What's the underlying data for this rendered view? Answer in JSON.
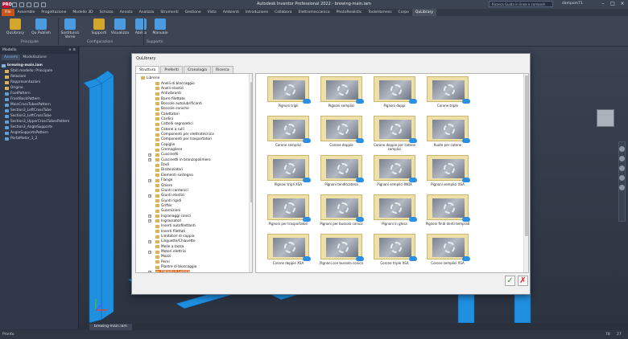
{
  "window": {
    "title": "Autodesk Inventor Professional 2022 - brewing-main.iam",
    "help_search_placeholder": "Ricerca Guida in linea e comandi",
    "user": "dampom71",
    "app_logo": "PRO"
  },
  "menu_tabs": [
    "File",
    "Assemble",
    "Progettazione",
    "Modello 3D",
    "Schizzo",
    "Annota",
    "Analizza",
    "Strumenti",
    "Gestione",
    "Vista",
    "Ambienti",
    "Introduzione",
    "Collabora",
    "Elettromeccanico",
    "PhotoRealistic",
    "ToolsHarness",
    "Corpo",
    "QuLibrary"
  ],
  "active_menu_tab": "QuLibrary",
  "ribbon": {
    "buttons": [
      {
        "label": "QuLibrary",
        "icon": "books-icon",
        "color": "#d4a72c"
      },
      {
        "label": "Qu Publish",
        "icon": "publish-icon",
        "color": "#4a9be0"
      },
      {
        "label": "Sostituisci Vorne",
        "icon": "replace-icon",
        "color": "#4a9be0"
      },
      {
        "label": "Supporti",
        "icon": "support-icon",
        "color": "#d4a72c"
      },
      {
        "label": "Visualizza",
        "icon": "view-icon",
        "color": "#4a9be0"
      },
      {
        "label": "Abilita",
        "icon": "enable-icon",
        "color": "#4a9be0"
      },
      {
        "label": "Manuale",
        "icon": "help-icon",
        "color": "#4a9be0"
      }
    ],
    "panels": [
      "Principale",
      "Configurazioni",
      "Supporto"
    ]
  },
  "browser": {
    "title": "Modello",
    "tabs": [
      "Assiemi",
      "Modellazione"
    ],
    "items": [
      {
        "label": "brewing-main.iam",
        "type": "asm"
      },
      {
        "label": "Stati modello: Principale",
        "type": "folder"
      },
      {
        "label": "Relazioni",
        "type": "folder"
      },
      {
        "label": "Rappresentazioni",
        "type": "folder"
      },
      {
        "label": "Origine",
        "type": "folder"
      },
      {
        "label": "FootPattern",
        "type": "part"
      },
      {
        "label": "FrontBackPattern",
        "type": "part"
      },
      {
        "label": "MainCrossTubesPattern",
        "type": "part"
      },
      {
        "label": "Section3_LeftCrossTube",
        "type": "part"
      },
      {
        "label": "Section3_LeftCrossTube",
        "type": "part"
      },
      {
        "label": "Section3_UpperCrossTubesPattern",
        "type": "part"
      },
      {
        "label": "Section3_AngleSupports",
        "type": "part"
      },
      {
        "label": "AngleSupportsPattern",
        "type": "part"
      },
      {
        "label": "PortaMotor_1_2",
        "type": "part"
      }
    ]
  },
  "doc_tab": "brewing-main.iam",
  "status": {
    "text": "Pronto",
    "count_a": "78",
    "count_b": "27"
  },
  "dialog": {
    "title": "QuLibrary",
    "tabs": [
      "Struttura",
      "Preferiti",
      "Cronologia",
      "Ricerca"
    ],
    "tree_root": "Librerie",
    "tree_items": [
      "Anelli di bloccaggio",
      "Anelli elastici",
      "Antivibranti",
      "Barre filettate",
      "Boccole autolubrificanti",
      "Boccole coniche",
      "Calettatori",
      "Cardini",
      "Cattelli segnaletici",
      "Catene a rulli",
      "Componenti per elettrotecnica",
      "Componenti per trasportatori",
      "Copiglie",
      "Cremagliere",
      "Cuscinetti",
      "Cuscinetti in bronzopolimero",
      "Dadi",
      "Distanziatori",
      "Elementi sostegno",
      "Flange",
      "Ghiere",
      "Giunti cardanici",
      "Giunti elastici",
      "Giunti rigidi",
      "Grifter",
      "Guarnizioni",
      "Ingranaggi conici",
      "Ingrassatori",
      "Inserti autofilettanti",
      "Inserti filettati",
      "Limitatori di coppia",
      "Linguette/Chiavette",
      "Molle a tazza",
      "Motori elettrici",
      "Mozzi",
      "Perni",
      "Piastre di bloccaggio",
      "Pignoni e Corone"
    ],
    "items": [
      "Pignoni tripli",
      "Pignoni semplici",
      "Pignoni doppi",
      "Corone triple",
      "Corone semplici",
      "Corone doppie",
      "Corone doppie per catene semplici",
      "Ruote per catene",
      "Pignoni tripli XSA",
      "Pignoni tenditcatena",
      "Pignoni semplici INOX",
      "Pignoni semplici XSA",
      "Pignoni per trasportatori",
      "Pignoni per bussola conica",
      "Pignoni in ghisa",
      "Pignoni finiti denti temprati",
      "Corone doppie XSA",
      "Pignoni con bussola conica",
      "Corone triple XSA",
      "Corone semplici XSA"
    ],
    "ok_label": "✓",
    "cancel_label": "✗"
  }
}
